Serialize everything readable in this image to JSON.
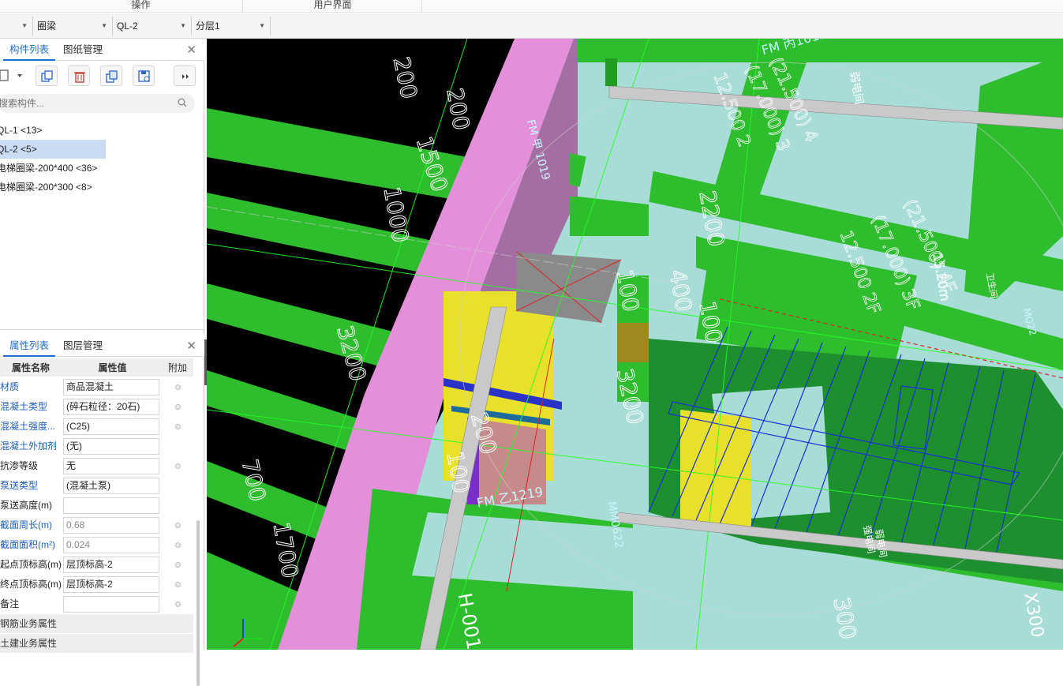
{
  "ribbon": {
    "groups": [
      "操作",
      "用户界面"
    ]
  },
  "selectors": {
    "category": "圈梁",
    "component": "QL-2",
    "layer": "分层1"
  },
  "component_panel": {
    "tabs": [
      "构件列表",
      "图纸管理"
    ],
    "search_placeholder": "搜索构件...",
    "items": [
      {
        "label": "QL-1 <13>",
        "selected": false
      },
      {
        "label": "QL-2 <5>",
        "selected": true
      },
      {
        "label": "电梯圈梁-200*400 <36>",
        "selected": false
      },
      {
        "label": "电梯圈梁-200*300 <8>",
        "selected": false
      }
    ]
  },
  "property_panel": {
    "tabs": [
      "属性列表",
      "图层管理"
    ],
    "headers": {
      "name": "属性名称",
      "value": "属性值",
      "add": "附加"
    },
    "rows": [
      {
        "name": "材质",
        "value": "商品混凝土",
        "link": true,
        "grey": false,
        "dot": true
      },
      {
        "name": "混凝土类型",
        "value": "(碎石粒径：20石)",
        "link": true,
        "grey": false,
        "dot": true
      },
      {
        "name": "混凝土强度...",
        "value": "(C25)",
        "link": true,
        "grey": false,
        "dot": true
      },
      {
        "name": "混凝土外加剂",
        "value": "(无)",
        "link": true,
        "grey": false,
        "dot": false
      },
      {
        "name": "抗渗等级",
        "value": "无",
        "link": false,
        "grey": false,
        "dot": true
      },
      {
        "name": "泵送类型",
        "value": "(混凝土泵)",
        "link": true,
        "grey": false,
        "dot": false
      },
      {
        "name": "泵送高度(m)",
        "value": "",
        "link": false,
        "grey": false,
        "dot": false
      },
      {
        "name": "截面周长(m)",
        "value": "0.68",
        "link": true,
        "grey": true,
        "dot": true
      },
      {
        "name": "截面面积(m²)",
        "value": "0.024",
        "link": true,
        "grey": true,
        "dot": true
      },
      {
        "name": "起点顶标高(m)",
        "value": "层顶标高-2",
        "link": false,
        "grey": false,
        "dot": true
      },
      {
        "name": "终点顶标高(m)",
        "value": "层顶标高-2",
        "link": false,
        "grey": false,
        "dot": true
      },
      {
        "name": "备注",
        "value": "",
        "link": false,
        "grey": false,
        "dot": true
      }
    ],
    "groups": [
      "钢筋业务属性",
      "土建业务属性"
    ]
  },
  "viewport_labels": {
    "dims": [
      "200",
      "200",
      "1500",
      "3200",
      "1000",
      "200",
      "100",
      "700",
      "1700",
      "3200",
      "100",
      "400",
      "100",
      "2200",
      "300"
    ],
    "elevations": [
      "(21.500) 4",
      "(17.000) 3",
      "12.500 2",
      "(21.500) 4F",
      "(17.000) 3F",
      "12.500 2F",
      "15.20m"
    ],
    "tags": [
      "FM 丙1019",
      "FM 乙1219",
      "MM0622",
      "FM 甲 1019",
      "H-001",
      "弱电间",
      "强电间",
      "弱电间",
      "卫生间",
      "MQ22",
      "X300"
    ]
  }
}
